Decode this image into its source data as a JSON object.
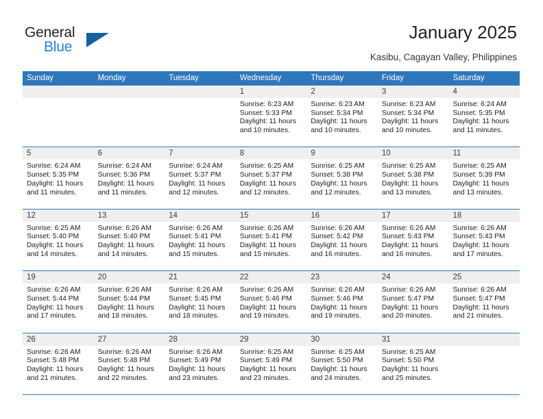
{
  "brand": {
    "name_part1": "General",
    "name_part2": "Blue"
  },
  "header": {
    "title": "January 2025",
    "location": "Kasibu, Cagayan Valley, Philippines"
  },
  "weekdays": [
    "Sunday",
    "Monday",
    "Tuesday",
    "Wednesday",
    "Thursday",
    "Friday",
    "Saturday"
  ],
  "colors": {
    "header_blue": "#2e77bb",
    "band_gray": "#efefef",
    "logo_blue": "#1f7fd4",
    "logo_triangle": "#15619e"
  },
  "weeks": [
    [
      {
        "day": ""
      },
      {
        "day": ""
      },
      {
        "day": ""
      },
      {
        "day": "1",
        "sunrise": "Sunrise: 6:23 AM",
        "sunset": "Sunset: 5:33 PM",
        "daylight1": "Daylight: 11 hours",
        "daylight2": "and 10 minutes."
      },
      {
        "day": "2",
        "sunrise": "Sunrise: 6:23 AM",
        "sunset": "Sunset: 5:34 PM",
        "daylight1": "Daylight: 11 hours",
        "daylight2": "and 10 minutes."
      },
      {
        "day": "3",
        "sunrise": "Sunrise: 6:23 AM",
        "sunset": "Sunset: 5:34 PM",
        "daylight1": "Daylight: 11 hours",
        "daylight2": "and 10 minutes."
      },
      {
        "day": "4",
        "sunrise": "Sunrise: 6:24 AM",
        "sunset": "Sunset: 5:35 PM",
        "daylight1": "Daylight: 11 hours",
        "daylight2": "and 11 minutes."
      }
    ],
    [
      {
        "day": "5",
        "sunrise": "Sunrise: 6:24 AM",
        "sunset": "Sunset: 5:35 PM",
        "daylight1": "Daylight: 11 hours",
        "daylight2": "and 11 minutes."
      },
      {
        "day": "6",
        "sunrise": "Sunrise: 6:24 AM",
        "sunset": "Sunset: 5:36 PM",
        "daylight1": "Daylight: 11 hours",
        "daylight2": "and 11 minutes."
      },
      {
        "day": "7",
        "sunrise": "Sunrise: 6:24 AM",
        "sunset": "Sunset: 5:37 PM",
        "daylight1": "Daylight: 11 hours",
        "daylight2": "and 12 minutes."
      },
      {
        "day": "8",
        "sunrise": "Sunrise: 6:25 AM",
        "sunset": "Sunset: 5:37 PM",
        "daylight1": "Daylight: 11 hours",
        "daylight2": "and 12 minutes."
      },
      {
        "day": "9",
        "sunrise": "Sunrise: 6:25 AM",
        "sunset": "Sunset: 5:38 PM",
        "daylight1": "Daylight: 11 hours",
        "daylight2": "and 12 minutes."
      },
      {
        "day": "10",
        "sunrise": "Sunrise: 6:25 AM",
        "sunset": "Sunset: 5:38 PM",
        "daylight1": "Daylight: 11 hours",
        "daylight2": "and 13 minutes."
      },
      {
        "day": "11",
        "sunrise": "Sunrise: 6:25 AM",
        "sunset": "Sunset: 5:39 PM",
        "daylight1": "Daylight: 11 hours",
        "daylight2": "and 13 minutes."
      }
    ],
    [
      {
        "day": "12",
        "sunrise": "Sunrise: 6:25 AM",
        "sunset": "Sunset: 5:40 PM",
        "daylight1": "Daylight: 11 hours",
        "daylight2": "and 14 minutes."
      },
      {
        "day": "13",
        "sunrise": "Sunrise: 6:26 AM",
        "sunset": "Sunset: 5:40 PM",
        "daylight1": "Daylight: 11 hours",
        "daylight2": "and 14 minutes."
      },
      {
        "day": "14",
        "sunrise": "Sunrise: 6:26 AM",
        "sunset": "Sunset: 5:41 PM",
        "daylight1": "Daylight: 11 hours",
        "daylight2": "and 15 minutes."
      },
      {
        "day": "15",
        "sunrise": "Sunrise: 6:26 AM",
        "sunset": "Sunset: 5:41 PM",
        "daylight1": "Daylight: 11 hours",
        "daylight2": "and 15 minutes."
      },
      {
        "day": "16",
        "sunrise": "Sunrise: 6:26 AM",
        "sunset": "Sunset: 5:42 PM",
        "daylight1": "Daylight: 11 hours",
        "daylight2": "and 16 minutes."
      },
      {
        "day": "17",
        "sunrise": "Sunrise: 6:26 AM",
        "sunset": "Sunset: 5:43 PM",
        "daylight1": "Daylight: 11 hours",
        "daylight2": "and 16 minutes."
      },
      {
        "day": "18",
        "sunrise": "Sunrise: 6:26 AM",
        "sunset": "Sunset: 5:43 PM",
        "daylight1": "Daylight: 11 hours",
        "daylight2": "and 17 minutes."
      }
    ],
    [
      {
        "day": "19",
        "sunrise": "Sunrise: 6:26 AM",
        "sunset": "Sunset: 5:44 PM",
        "daylight1": "Daylight: 11 hours",
        "daylight2": "and 17 minutes."
      },
      {
        "day": "20",
        "sunrise": "Sunrise: 6:26 AM",
        "sunset": "Sunset: 5:44 PM",
        "daylight1": "Daylight: 11 hours",
        "daylight2": "and 18 minutes."
      },
      {
        "day": "21",
        "sunrise": "Sunrise: 6:26 AM",
        "sunset": "Sunset: 5:45 PM",
        "daylight1": "Daylight: 11 hours",
        "daylight2": "and 18 minutes."
      },
      {
        "day": "22",
        "sunrise": "Sunrise: 6:26 AM",
        "sunset": "Sunset: 5:46 PM",
        "daylight1": "Daylight: 11 hours",
        "daylight2": "and 19 minutes."
      },
      {
        "day": "23",
        "sunrise": "Sunrise: 6:26 AM",
        "sunset": "Sunset: 5:46 PM",
        "daylight1": "Daylight: 11 hours",
        "daylight2": "and 19 minutes."
      },
      {
        "day": "24",
        "sunrise": "Sunrise: 6:26 AM",
        "sunset": "Sunset: 5:47 PM",
        "daylight1": "Daylight: 11 hours",
        "daylight2": "and 20 minutes."
      },
      {
        "day": "25",
        "sunrise": "Sunrise: 6:26 AM",
        "sunset": "Sunset: 5:47 PM",
        "daylight1": "Daylight: 11 hours",
        "daylight2": "and 21 minutes."
      }
    ],
    [
      {
        "day": "26",
        "sunrise": "Sunrise: 6:26 AM",
        "sunset": "Sunset: 5:48 PM",
        "daylight1": "Daylight: 11 hours",
        "daylight2": "and 21 minutes."
      },
      {
        "day": "27",
        "sunrise": "Sunrise: 6:26 AM",
        "sunset": "Sunset: 5:48 PM",
        "daylight1": "Daylight: 11 hours",
        "daylight2": "and 22 minutes."
      },
      {
        "day": "28",
        "sunrise": "Sunrise: 6:26 AM",
        "sunset": "Sunset: 5:49 PM",
        "daylight1": "Daylight: 11 hours",
        "daylight2": "and 23 minutes."
      },
      {
        "day": "29",
        "sunrise": "Sunrise: 6:25 AM",
        "sunset": "Sunset: 5:49 PM",
        "daylight1": "Daylight: 11 hours",
        "daylight2": "and 23 minutes."
      },
      {
        "day": "30",
        "sunrise": "Sunrise: 6:25 AM",
        "sunset": "Sunset: 5:50 PM",
        "daylight1": "Daylight: 11 hours",
        "daylight2": "and 24 minutes."
      },
      {
        "day": "31",
        "sunrise": "Sunrise: 6:25 AM",
        "sunset": "Sunset: 5:50 PM",
        "daylight1": "Daylight: 11 hours",
        "daylight2": "and 25 minutes."
      },
      {
        "day": ""
      }
    ]
  ]
}
